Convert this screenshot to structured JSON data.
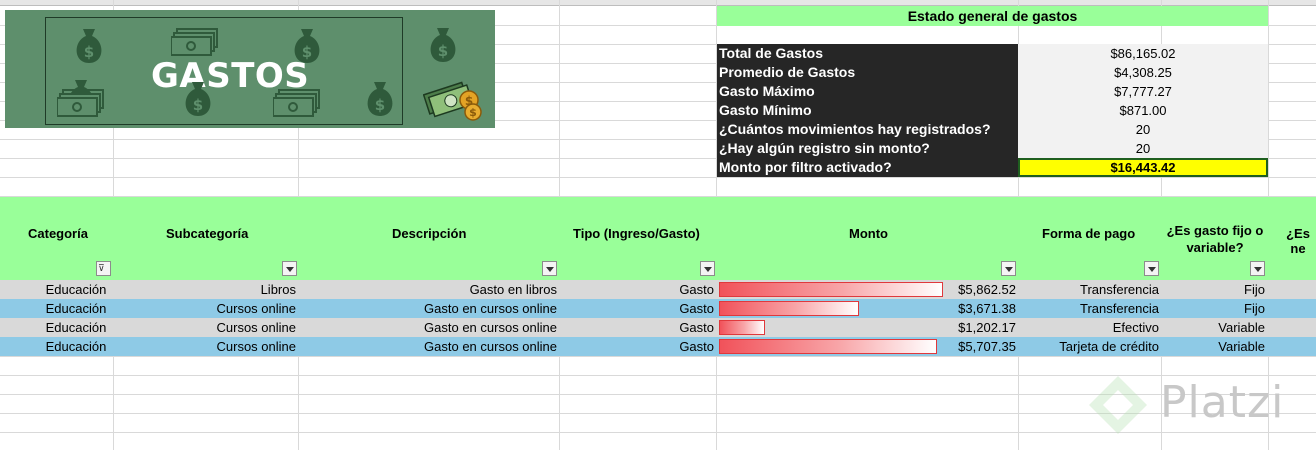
{
  "banner": {
    "title": "GASTOS"
  },
  "summary": {
    "title": "Estado general de gastos",
    "rows": [
      {
        "label": "Total de Gastos",
        "value": "$86,165.02"
      },
      {
        "label": "Promedio de Gastos",
        "value": "$4,308.25"
      },
      {
        "label": "Gasto Máximo",
        "value": "$7,777.27"
      },
      {
        "label": "Gasto Mínimo",
        "value": "$871.00"
      },
      {
        "label": "¿Cuántos movimientos hay registrados?",
        "value": "20"
      },
      {
        "label": "¿Hay algún registro sin monto?",
        "value": "20"
      },
      {
        "label": "Monto por filtro activado?",
        "value": "$16,443.42"
      }
    ]
  },
  "table": {
    "headers": {
      "categoria": "Categoría",
      "subcategoria": "Subcategoría",
      "descripcion": "Descripción",
      "tipo": "Tipo (Ingreso/Gasto)",
      "monto": "Monto",
      "forma_pago": "Forma de pago",
      "fijo_variable_1": "¿Es gasto fijo o",
      "fijo_variable_2": "variable?",
      "necesario": "¿Es ne"
    },
    "rows": [
      {
        "categoria": "Educación",
        "subcategoria": "Libros",
        "descripcion": "Gasto en libros",
        "tipo": "Gasto",
        "monto": "$5,862.52",
        "monto_value": 5862.52,
        "forma_pago": "Transferencia",
        "fijo": "Fijo"
      },
      {
        "categoria": "Educación",
        "subcategoria": "Cursos online",
        "descripcion": "Gasto en cursos online",
        "tipo": "Gasto",
        "monto": "$3,671.38",
        "monto_value": 3671.38,
        "forma_pago": "Transferencia",
        "fijo": "Fijo"
      },
      {
        "categoria": "Educación",
        "subcategoria": "Cursos online",
        "descripcion": "Gasto en cursos online",
        "tipo": "Gasto",
        "monto": "$1,202.17",
        "monto_value": 1202.17,
        "forma_pago": "Efectivo",
        "fijo": "Variable"
      },
      {
        "categoria": "Educación",
        "subcategoria": "Cursos online",
        "descripcion": "Gasto en cursos online",
        "tipo": "Gasto",
        "monto": "$5,707.35",
        "monto_value": 5707.35,
        "forma_pago": "Tarjeta de crédito",
        "fijo": "Variable"
      }
    ]
  },
  "watermark": {
    "text": "Platzi"
  },
  "colors": {
    "header_green": "#99ff99",
    "summary_dark": "#262626",
    "highlight": "#ffff00",
    "row_blue": "#8ecae6",
    "row_grey": "#d9d9d9",
    "bar_red": "#f1525a"
  }
}
